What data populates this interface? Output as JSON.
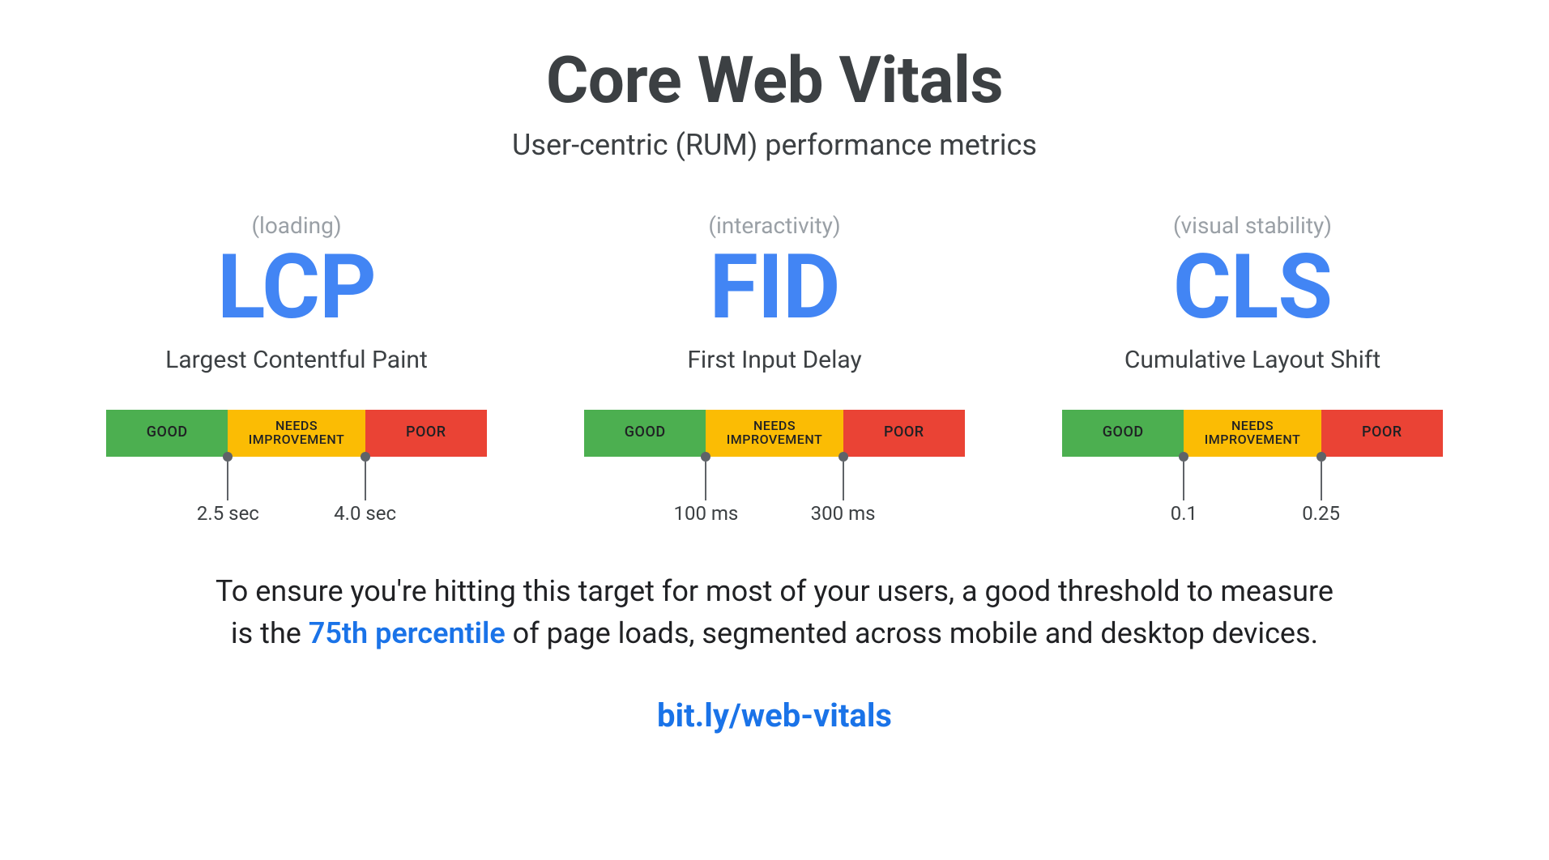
{
  "title": "Core Web Vitals",
  "subtitle": "User-centric (RUM) performance metrics",
  "segments": {
    "good": "GOOD",
    "needs": "NEEDS\nIMPROVEMENT",
    "poor": "POOR"
  },
  "metrics": [
    {
      "category": "(loading)",
      "acronym": "LCP",
      "fullname": "Largest Contentful Paint",
      "threshold1": "2.5 sec",
      "threshold2": "4.0 sec"
    },
    {
      "category": "(interactivity)",
      "acronym": "FID",
      "fullname": "First Input Delay",
      "threshold1": "100 ms",
      "threshold2": "300 ms"
    },
    {
      "category": "(visual stability)",
      "acronym": "CLS",
      "fullname": "Cumulative Layout Shift",
      "threshold1": "0.1",
      "threshold2": "0.25"
    }
  ],
  "footer": {
    "pre": "To ensure you're hitting this target for most of your users, a good threshold to measure is the ",
    "highlight": "75th percentile",
    "post": " of page loads, segmented across mobile and desktop devices."
  },
  "link": "bit.ly/web-vitals"
}
